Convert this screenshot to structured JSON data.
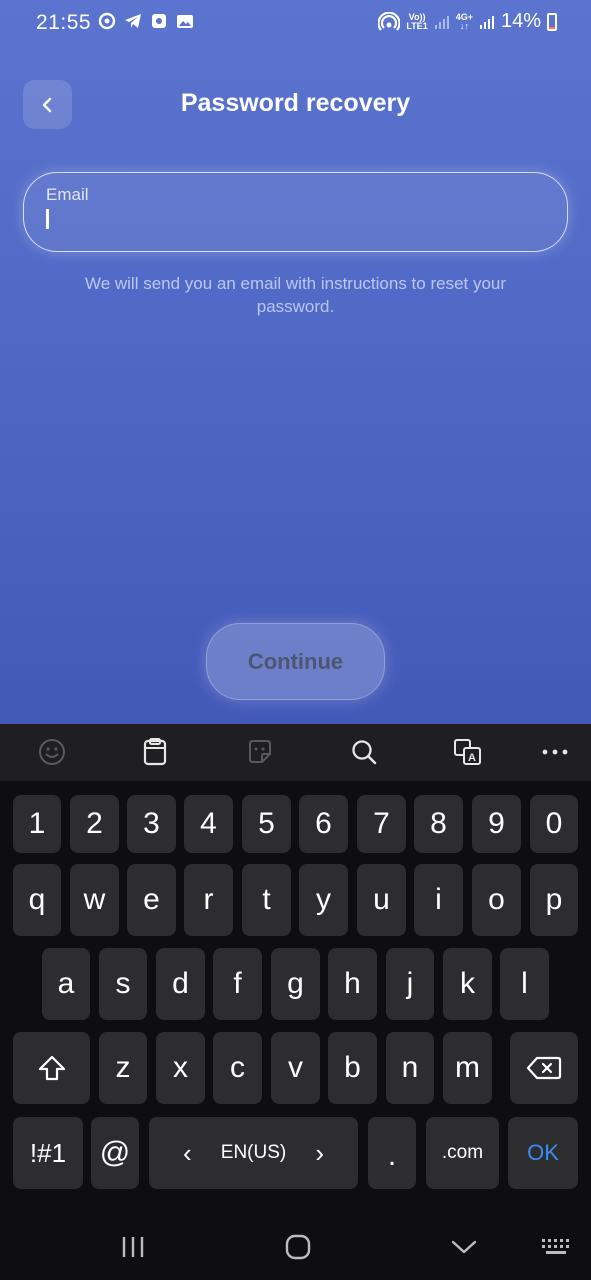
{
  "status_bar": {
    "time": "21:55",
    "volte_top": "Vo))",
    "volte_bottom": "LTE1",
    "net_top": "4G+",
    "net_bottom": "↓↑",
    "battery_percent": "14%",
    "battery_level": 0.14
  },
  "header": {
    "title": "Password recovery",
    "back_icon": "chevron-left-icon"
  },
  "form": {
    "email_label": "Email",
    "email_value": "",
    "helper_text": "We will send you an email with instructions to reset your password.",
    "continue_label": "Continue"
  },
  "keyboard": {
    "toolbar_icons": [
      "emoji-icon",
      "clipboard-icon",
      "sticker-icon",
      "search-icon",
      "translate-icon",
      "more-icon"
    ],
    "row_numbers": [
      "1",
      "2",
      "3",
      "4",
      "5",
      "6",
      "7",
      "8",
      "9",
      "0"
    ],
    "row_1": [
      "q",
      "w",
      "e",
      "r",
      "t",
      "y",
      "u",
      "i",
      "o",
      "p"
    ],
    "row_2": [
      "a",
      "s",
      "d",
      "f",
      "g",
      "h",
      "j",
      "k",
      "l"
    ],
    "row_3": [
      "z",
      "x",
      "c",
      "v",
      "b",
      "n",
      "m"
    ],
    "symbols_label": "!#1",
    "at_label": "@",
    "language_label": "EN(US)",
    "lang_prev": "‹",
    "lang_next": "›",
    "period_label": ".",
    "com_label": ".com",
    "ok_label": "OK"
  },
  "colors": {
    "background_top": "#5b74cf",
    "background_bottom": "#4359b8",
    "ok_blue": "#3b8cf2",
    "key_bg": "#2d2d30"
  }
}
